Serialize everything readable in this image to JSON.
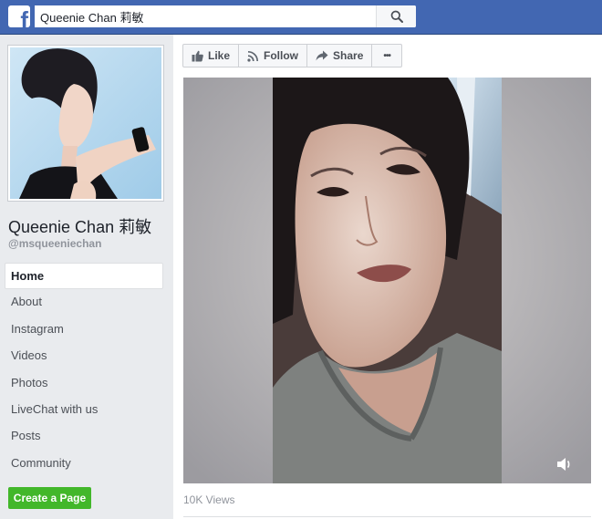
{
  "search": {
    "value": "Queenie Chan 莉敏",
    "logo": "f"
  },
  "profile": {
    "name": "Queenie Chan 莉敏",
    "handle": "@msqueeniechan"
  },
  "nav": {
    "items": [
      {
        "label": "Home",
        "active": true
      },
      {
        "label": "About"
      },
      {
        "label": "Instagram"
      },
      {
        "label": "Videos"
      },
      {
        "label": "Photos"
      },
      {
        "label": "LiveChat with us"
      },
      {
        "label": "Posts"
      },
      {
        "label": "Community"
      }
    ],
    "create_page": "Create a Page"
  },
  "actions": {
    "like": "Like",
    "follow": "Follow",
    "share": "Share",
    "more": "•••"
  },
  "video": {
    "views": "10K Views"
  },
  "colors": {
    "brand": "#4267b2",
    "create_button": "#42b72a"
  },
  "icons": [
    "facebook-logo-icon",
    "search-icon",
    "like-icon",
    "follow-icon",
    "share-icon",
    "more-icon",
    "volume-icon"
  ]
}
